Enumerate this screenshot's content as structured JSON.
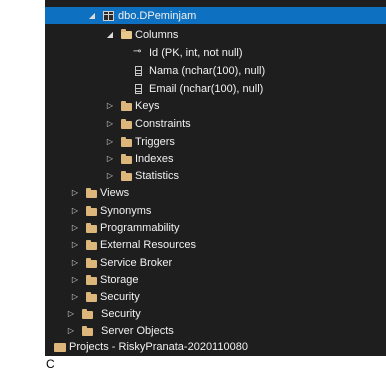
{
  "tree": {
    "table_node": "dbo.DPeminjam",
    "columns_folder": "Columns",
    "columns": [
      "Id (PK, int, not null)",
      "Nama (nchar(100), null)",
      "Email (nchar(100), null)"
    ],
    "table_children": [
      "Keys",
      "Constraints",
      "Triggers",
      "Indexes",
      "Statistics"
    ],
    "db_children": [
      "Views",
      "Synonyms",
      "Programmability",
      "External Resources",
      "Service Broker",
      "Storage",
      "Security"
    ],
    "server_children": [
      "Security",
      "Server Objects"
    ],
    "project": "Projects - RiskyPranata-2020110080"
  },
  "colors": {
    "panel_bg": "#1e1e1e",
    "selected_bg": "#0e70c0",
    "folder": "#dcb67a",
    "text": "#f1f1f1"
  },
  "partial_text": "C"
}
